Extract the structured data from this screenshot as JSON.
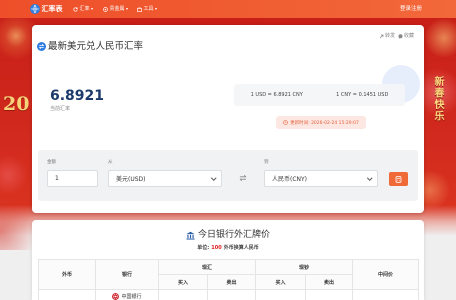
{
  "navbar": {
    "logo_text": "汇率表",
    "items": [
      {
        "label": "汇率",
        "icon": "refresh-icon"
      },
      {
        "label": "贵金属",
        "icon": "coin-icon"
      },
      {
        "label": "工具",
        "icon": "toolbox-icon"
      }
    ],
    "login_label": "登录注册"
  },
  "hero": {
    "year_text": "20",
    "greeting": "新春快乐"
  },
  "rate_card": {
    "actions": {
      "share": "转发",
      "favorite": "收藏"
    },
    "title": "最新美元兑人民币汇率",
    "rate": "6.8921",
    "rate_label": "当前汇率",
    "forward_pair": "1 USD = 6.8921 CNY",
    "reverse_pair": "1 CNY = 0.1451 USD",
    "updated": "更新时间: 2026-02-24 15:29:07"
  },
  "converter": {
    "amount_label": "金额",
    "amount_value": "1",
    "from_label": "从",
    "from_value": "美元(USD)",
    "to_label": "到",
    "to_value": "人民币(CNY)"
  },
  "bank_card": {
    "title": "今日银行外汇牌价",
    "unit_label": "单位:",
    "unit_amount": "100",
    "unit_text": "外币换算人民币",
    "table": {
      "col_currency": "外币",
      "col_bank": "银行",
      "col_spot": "现汇",
      "col_cash": "现钞",
      "col_middle": "中间价",
      "buy": "买入",
      "sell": "卖出",
      "rows": [
        {
          "bank": "中国银行",
          "bank_icon": "bank-of-china-logo-icon"
        }
      ]
    }
  },
  "colors": {
    "navbar_orange": "#f05a2e",
    "hero_red": "#d22a1e",
    "brand_blue": "#2f7de1",
    "rate_navy": "#1b3a6b",
    "highlight_red": "#e02020",
    "festive_gold": "#f6d27a",
    "convert_button": "#f06a37"
  }
}
